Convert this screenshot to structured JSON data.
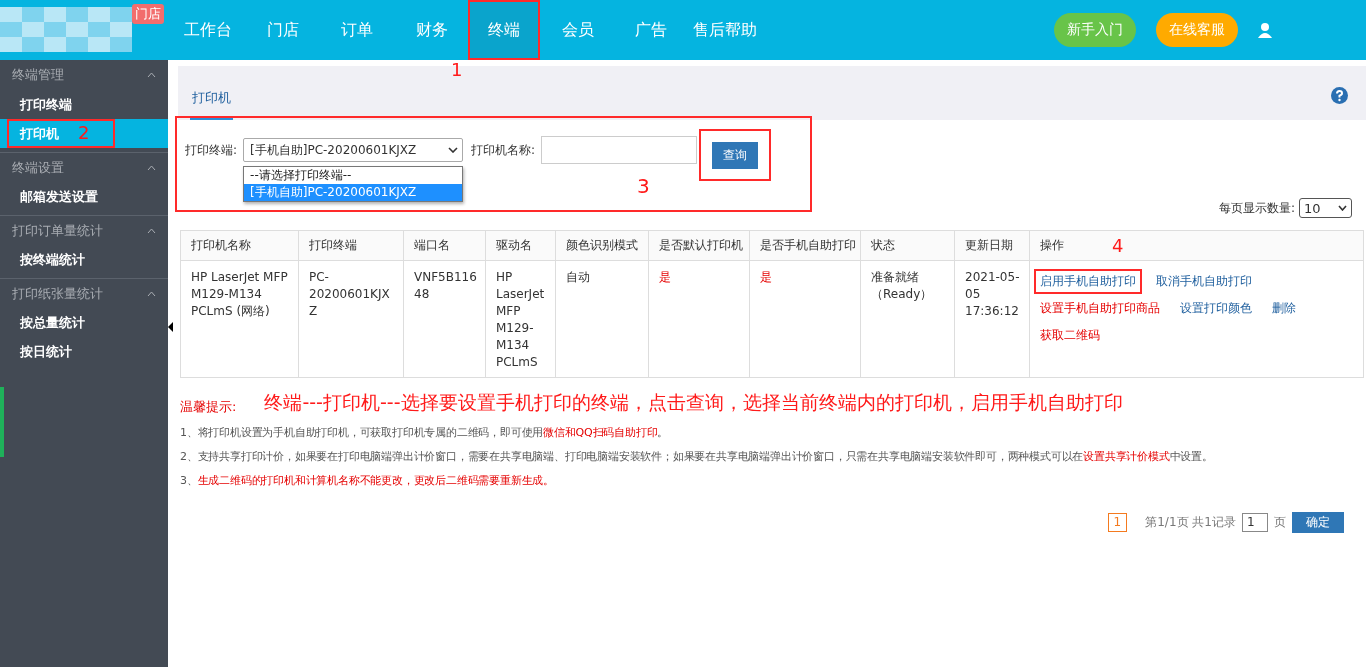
{
  "header": {
    "logo_badge": "门店",
    "nav": [
      {
        "label": "工作台",
        "selected": false,
        "annotated": false
      },
      {
        "label": "门店",
        "selected": false,
        "annotated": false
      },
      {
        "label": "订单",
        "selected": false,
        "annotated": false
      },
      {
        "label": "财务",
        "selected": false,
        "annotated": false
      },
      {
        "label": "终端",
        "selected": true,
        "annotated": true,
        "note": "1"
      },
      {
        "label": "会员",
        "selected": false,
        "annotated": false
      },
      {
        "label": "广告",
        "selected": false,
        "annotated": false
      },
      {
        "label": "售后帮助",
        "selected": false,
        "annotated": false
      }
    ],
    "buttons": [
      {
        "label": "新手入门",
        "kind": "guide"
      },
      {
        "label": "在线客服",
        "kind": "service"
      }
    ]
  },
  "sidebar": {
    "groups": [
      {
        "title": "终端管理",
        "expanded": true,
        "items": [
          {
            "label": "打印终端",
            "selected": false,
            "annotated": false
          },
          {
            "label": "打印机",
            "selected": true,
            "annotated": true,
            "note": "2"
          }
        ]
      },
      {
        "title": "终端设置",
        "expanded": true,
        "items": [
          {
            "label": "邮箱发送设置",
            "selected": false,
            "annotated": false
          }
        ]
      },
      {
        "title": "打印订单量统计",
        "expanded": true,
        "items": [
          {
            "label": "按终端统计",
            "selected": false,
            "annotated": false
          }
        ]
      },
      {
        "title": "打印纸张量统计",
        "expanded": true,
        "items": [
          {
            "label": "按总量统计",
            "selected": false,
            "annotated": false
          },
          {
            "label": "按日统计",
            "selected": false,
            "annotated": false
          }
        ]
      }
    ]
  },
  "tabs": [
    {
      "label": "打印机",
      "selected": true
    }
  ],
  "filter": {
    "annotated": true,
    "note": "3",
    "terminal_label": "打印终端:",
    "terminal_value": "[手机自助]PC-20200601KJXZ",
    "terminal_options": [
      {
        "label": "--请选择打印终端--",
        "selected": false
      },
      {
        "label": "[手机自助]PC-20200601KJXZ",
        "selected": true
      }
    ],
    "name_label": "打印机名称:",
    "query_button": "查询",
    "query_annotated": true
  },
  "page_size": {
    "label": "每页显示数量:",
    "value": "10"
  },
  "table": {
    "columns": [
      "打印机名称",
      "打印终端",
      "端口名",
      "驱动名",
      "颜色识别模式",
      "是否默认打印机",
      "是否手机自助打印",
      "状态",
      "更新日期",
      "操作"
    ],
    "actions_note": "4",
    "rows": [
      {
        "cells": [
          {
            "text": "HP LaserJet MFP M129-M134 PCLmS (网络)",
            "alert": false
          },
          {
            "text": "PC-20200601KJXZ",
            "alert": false
          },
          {
            "text": "VNF5B11648",
            "alert": false
          },
          {
            "text": "HP LaserJet MFP M129-M134 PCLmS",
            "alert": false
          },
          {
            "text": "自动",
            "alert": false
          },
          {
            "text": "是",
            "alert": true
          },
          {
            "text": "是",
            "alert": true
          },
          {
            "text": "准备就绪（Ready）",
            "alert": false
          },
          {
            "text": "2021-05-05 17:36:12",
            "alert": false
          }
        ],
        "actions": [
          {
            "label": "启用手机自助打印",
            "danger": false,
            "annotated": true
          },
          {
            "label": "取消手机自助打印",
            "danger": false,
            "annotated": false
          },
          {
            "label": "设置手机自助打印商品",
            "danger": true,
            "annotated": false
          },
          {
            "label": "设置打印颜色",
            "danger": false,
            "annotated": false
          },
          {
            "label": "删除",
            "danger": false,
            "annotated": false
          },
          {
            "label": "获取二维码",
            "danger": true,
            "annotated": false
          }
        ]
      }
    ]
  },
  "tips": {
    "title": "温馨提示:",
    "banner": "终端---打印机---选择要设置手机打印的终端，点击查询，选择当前终端内的打印机，启用手机自助打印",
    "lines": [
      [
        {
          "text": "1、将打印机设置为手机自助打印机，可获取打印机专属的二维码，即可使用",
          "alert": false
        },
        {
          "text": "微信和QQ扫码自助打印",
          "alert": true
        },
        {
          "text": "。",
          "alert": false
        }
      ],
      [
        {
          "text": "2、支持共享打印计价，如果要在打印电脑端弹出计价窗口，需要在共享电脑端、打印电脑端安装软件；如果要在共享电脑端弹出计价窗口，只需在共享电脑端安装软件即可，两种模式可以在",
          "alert": false
        },
        {
          "text": "设置共享计价模式",
          "alert": true
        },
        {
          "text": "中设置。",
          "alert": false
        }
      ],
      [
        {
          "text": "3、",
          "alert": false
        },
        {
          "text": "生成二维码的打印机和计算机名称不能更改，更改后二维码需要重新生成。",
          "alert": true
        }
      ]
    ]
  },
  "pagination": {
    "pages": [
      {
        "label": "1",
        "selected": true
      }
    ],
    "summary": "第1/1页 共1记录",
    "page_input": "1",
    "page_unit": "页",
    "confirm": "确定"
  }
}
